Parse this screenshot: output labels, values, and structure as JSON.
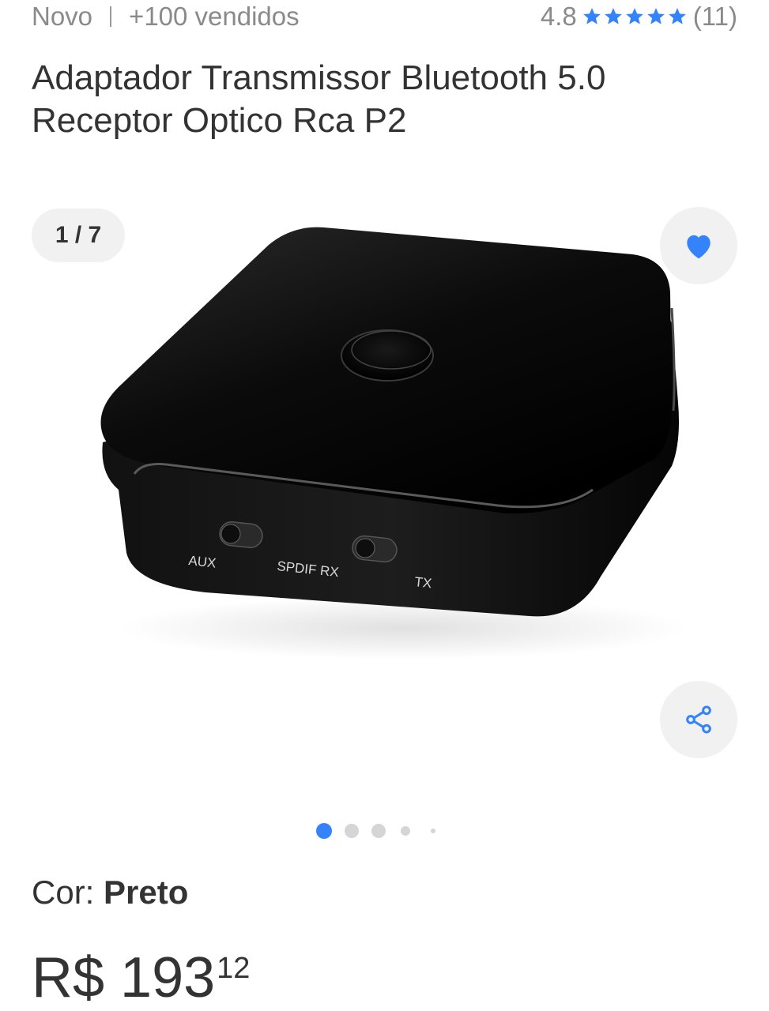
{
  "header": {
    "condition": "Novo",
    "sold": "+100 vendidos",
    "rating_value": "4.8",
    "rating_stars": 5,
    "rating_count": "(11)"
  },
  "product": {
    "title": "Adaptador Transmissor Bluetooth 5.0 Receptor Optico Rca P2",
    "image_labels": {
      "aux": "AUX",
      "spdif_rx": "SPDIF RX",
      "tx": "TX"
    }
  },
  "gallery": {
    "counter": "1 / 7",
    "favorite_icon": "heart-icon",
    "share_icon": "share-icon",
    "active_index": 0
  },
  "variation": {
    "label": "Cor: ",
    "value": "Preto"
  },
  "price": {
    "currency_integer": "R$ 193",
    "cents": "12"
  },
  "colors": {
    "accent": "#3483fa",
    "star": "#3483fa",
    "muted_text": "#8a8a8a",
    "chip_bg": "#f1f1f1"
  }
}
